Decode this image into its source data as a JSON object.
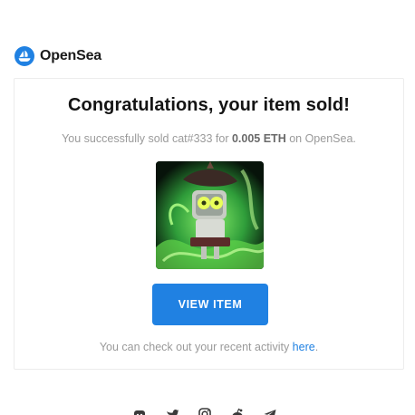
{
  "brand": {
    "name": "OpenSea",
    "accent_color": "#2081e2"
  },
  "card": {
    "headline": "Congratulations, your item sold!",
    "sold_prefix": "You successfully sold ",
    "item_name": "cat#333",
    "for_text": " for ",
    "price": "0.005 ETH",
    "on_text": " on OpenSea.",
    "image_icon": "nft-artwork-image",
    "button_label": "VIEW ITEM",
    "footer_prefix": "You can check out your recent activity ",
    "footer_link": "here",
    "footer_suffix": "."
  },
  "socials": {
    "icons": [
      "discord-icon",
      "twitter-icon",
      "instagram-icon",
      "reddit-icon",
      "telegram-icon"
    ]
  }
}
